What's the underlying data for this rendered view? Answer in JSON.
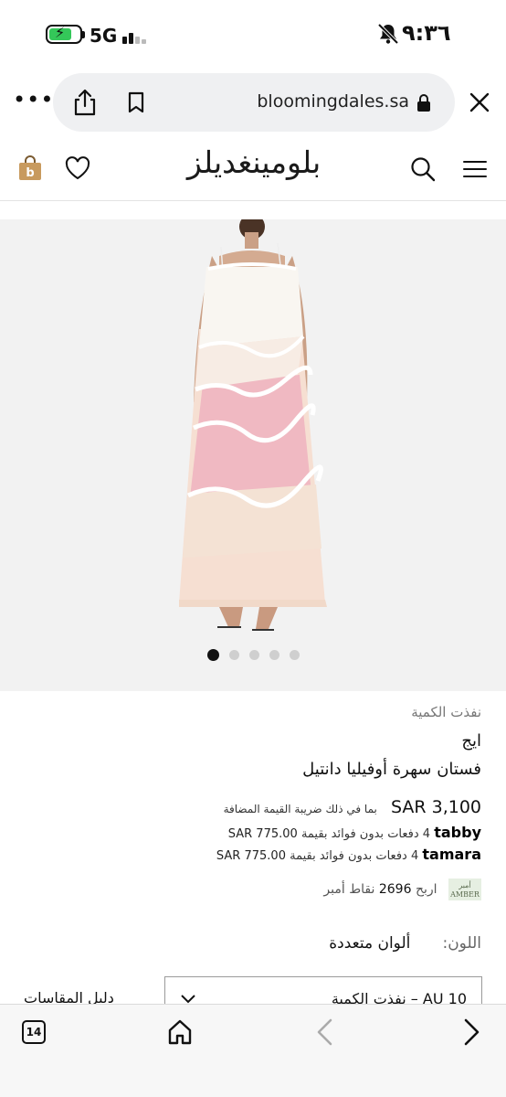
{
  "status_bar": {
    "network": "5G",
    "time": "٩:٣٦",
    "battery_color": "#34c759"
  },
  "browser": {
    "domain": "bloomingdales.sa",
    "icons": [
      "more-icon",
      "share-icon",
      "bookmark-icon",
      "lock-icon",
      "close-icon"
    ]
  },
  "site_header": {
    "logo_text": "بلومينغديلز",
    "icons": [
      "bag-icon",
      "heart-icon",
      "search-icon",
      "menu-icon"
    ]
  },
  "carousel": {
    "total_slides": 5,
    "active_slide": 1
  },
  "product": {
    "breadcrumb": "نفذت الكمية",
    "brand": "ايج",
    "name": "فستان سهرة أوفيليا دانتيل",
    "price": "SAR 3,100",
    "vat_note": "بما في ذلك ضريبة القيمة المضافة",
    "tabby": {
      "brand": "tabby",
      "text": "4 دفعات بدون فوائد بقيمة",
      "amount": "SAR 775.00"
    },
    "tamara": {
      "brand": "tamara",
      "text": "4 دفعات بدون فوائد بقيمة",
      "amount": "SAR 775.00"
    },
    "rewards": {
      "badge": "AMBER",
      "prefix": "اربح",
      "points": "2696",
      "suffix": "نقاط أمبر"
    },
    "color": {
      "label": "اللون:",
      "value": "ألوان متعددة"
    },
    "size": {
      "selected": "AU 10 – نفذت الكمية",
      "guide_label": "دليل المقاسات"
    }
  },
  "toolbar": {
    "tab_count": "14",
    "icons": [
      "tabs-button",
      "home-icon",
      "back-icon",
      "forward-icon"
    ]
  }
}
